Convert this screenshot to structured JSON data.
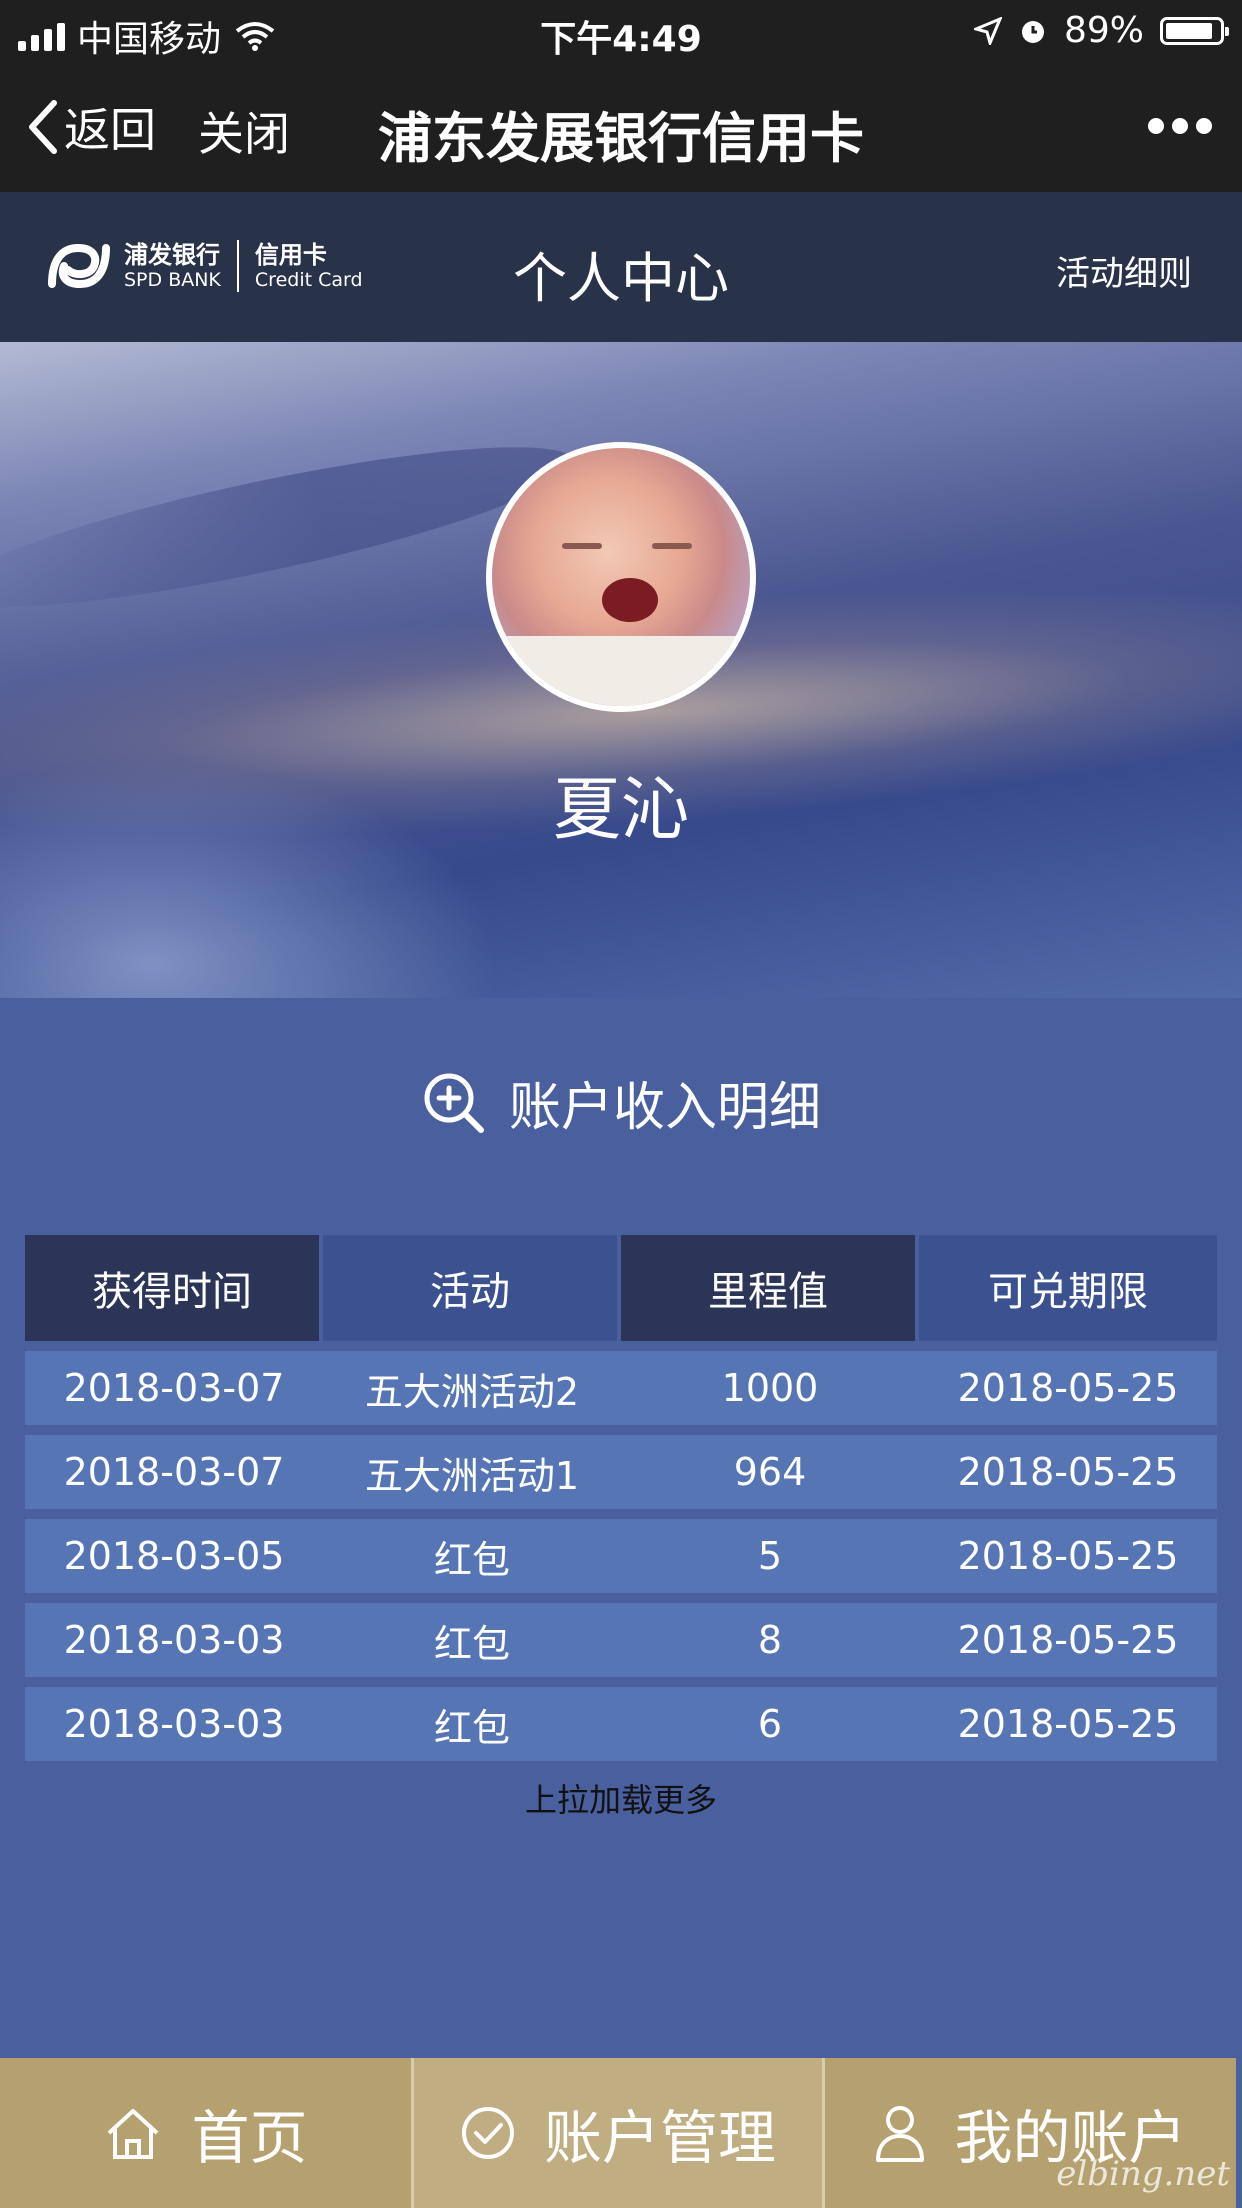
{
  "status_bar": {
    "carrier": "中国移动",
    "time": "下午4:49",
    "battery": "89%",
    "battery_level": 0.89
  },
  "nav": {
    "back_label": "返回",
    "close_label": "关闭",
    "title": "浦东发展银行信用卡"
  },
  "app_header": {
    "logo_cn": "浦发银行",
    "logo_en": "SPD BANK",
    "logo_card_cn": "信用卡",
    "logo_card_en": "Credit Card",
    "title": "个人中心",
    "rules_link": "活动细则"
  },
  "profile": {
    "name": "夏沁"
  },
  "income": {
    "title": "账户收入明细",
    "columns": [
      "获得时间",
      "活动",
      "里程值",
      "可兑期限"
    ],
    "rows": [
      [
        "2018-03-07",
        "五大洲活动2",
        "1000",
        "2018-05-25"
      ],
      [
        "2018-03-07",
        "五大洲活动1",
        "964",
        "2018-05-25"
      ],
      [
        "2018-03-05",
        "红包",
        "5",
        "2018-05-25"
      ],
      [
        "2018-03-03",
        "红包",
        "8",
        "2018-05-25"
      ],
      [
        "2018-03-03",
        "红包",
        "6",
        "2018-05-25"
      ]
    ],
    "load_more": "上拉加载更多"
  },
  "tabs": [
    {
      "label": "首页",
      "icon": "home-icon"
    },
    {
      "label": "账户管理",
      "icon": "check-circle-icon"
    },
    {
      "label": "我的账户",
      "icon": "user-icon"
    }
  ],
  "watermark": "elbing.net"
}
